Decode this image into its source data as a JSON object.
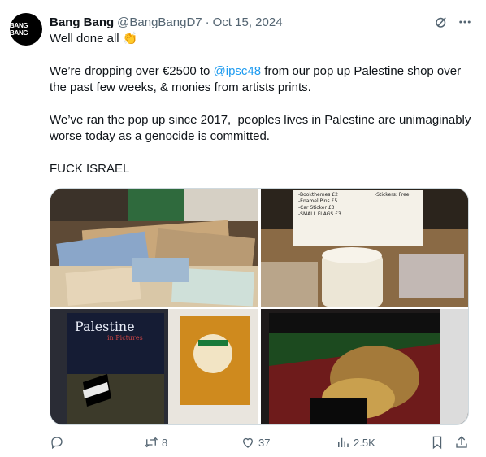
{
  "author": {
    "display_name": "Bang Bang",
    "handle": "@BangBangD7",
    "separator": "·",
    "date": "Oct 15, 2024",
    "avatar_text": "BANG BANG"
  },
  "tweet": {
    "line1": "Well done all 👏",
    "line2a": "We’re dropping over €2500 to ",
    "mention": "@ipsc48",
    "line2b": " from our pop up Palestine shop over the past few weeks, & monies from artists prints.",
    "line3": "We’ve ran the pop up since 2017,  peoples lives in Palestine are unimaginably worse today as a genocide is committed.",
    "line4": "FUCK ISRAEL"
  },
  "photos": {
    "photo2_sign": [
      "-Bookthemes £2",
      "-Enamel Pins £5",
      "-Car Sticker £3",
      "-SMALL FLAGS £3",
      "-Stickers: Free"
    ],
    "photo3_title": "Palestine",
    "photo3_subtitle": "in Pictures"
  },
  "actions": {
    "reply_count": "",
    "retweet_count": "8",
    "like_count": "37",
    "views_count": "2.5K"
  },
  "colors": {
    "text": "#0f1419",
    "secondary": "#536471",
    "link": "#1d9bf0"
  },
  "icons": [
    "grok-icon",
    "more-icon",
    "reply-icon",
    "retweet-icon",
    "like-icon",
    "views-icon",
    "bookmark-icon",
    "share-icon"
  ]
}
